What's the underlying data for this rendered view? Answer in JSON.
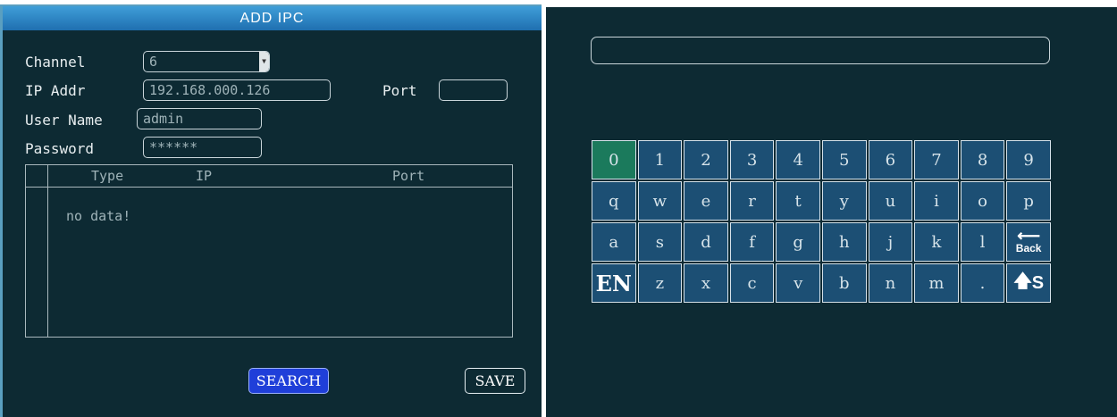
{
  "dialog": {
    "title": "ADD IPC",
    "channel_label": "Channel",
    "channel_value": "6",
    "ip_label": "IP Addr",
    "ip_value": "192.168.000.126",
    "port_label": "Port",
    "port_value": "",
    "username_label": "User Name",
    "username_value": "admin",
    "password_label": "Password",
    "password_value": "******",
    "table": {
      "headers": [
        "Type",
        "IP",
        "Port"
      ],
      "empty_text": "no data!"
    },
    "search_label": "SEARCH",
    "save_label": "SAVE"
  },
  "keyboard": {
    "input_value": "",
    "rows": [
      [
        "0",
        "1",
        "2",
        "3",
        "4",
        "5",
        "6",
        "7",
        "8",
        "9"
      ],
      [
        "q",
        "w",
        "e",
        "r",
        "t",
        "y",
        "u",
        "i",
        "o",
        "p"
      ],
      [
        "a",
        "s",
        "d",
        "f",
        "g",
        "h",
        "j",
        "k",
        "l",
        "Back"
      ],
      [
        "EN",
        "z",
        "x",
        "c",
        "v",
        "b",
        "n",
        "m",
        ".",
        "S"
      ]
    ],
    "active_key": "0",
    "icons": {
      "back": "backspace-arrow-icon",
      "shift": "shift-up-arrow-icon"
    }
  },
  "colors": {
    "panel_bg": "#0d2a33",
    "title_bar": "#2a86c8",
    "key_bg": "#1c4f74",
    "key_active": "#1b7a5c",
    "search_button": "#1f3fd9"
  }
}
